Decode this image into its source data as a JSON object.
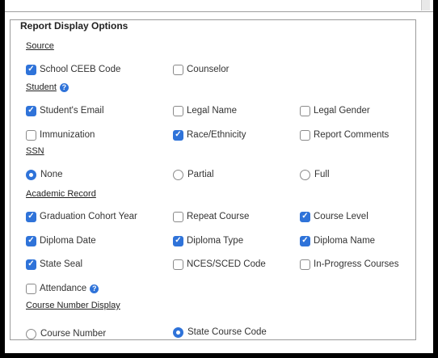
{
  "colors": {
    "accent": "#2f73d9",
    "border": "#9a9a9a",
    "text": "#222222"
  },
  "fieldset": {
    "legend": "Report Display Options"
  },
  "source": {
    "label": "Source",
    "options": [
      {
        "label": "School CEEB Code",
        "checked": true
      },
      {
        "label": "Counselor",
        "checked": false
      }
    ]
  },
  "student": {
    "label": "Student",
    "help_icon": "help-icon",
    "options": [
      {
        "label": "Student's Email",
        "checked": true
      },
      {
        "label": "Legal Name",
        "checked": false
      },
      {
        "label": "Legal Gender",
        "checked": false
      },
      {
        "label": "Immunization",
        "checked": false
      },
      {
        "label": "Race/Ethnicity",
        "checked": true
      },
      {
        "label": "Report Comments",
        "checked": false
      }
    ]
  },
  "ssn": {
    "label": "SSN",
    "options": [
      {
        "label": "None",
        "selected": true
      },
      {
        "label": "Partial",
        "selected": false
      },
      {
        "label": "Full",
        "selected": false
      }
    ]
  },
  "academic": {
    "label": "Academic Record",
    "help_icon": "help-icon",
    "options": [
      {
        "label": "Graduation Cohort Year",
        "checked": true
      },
      {
        "label": "Repeat Course",
        "checked": false
      },
      {
        "label": "Course Level",
        "checked": true
      },
      {
        "label": "Diploma Date",
        "checked": true
      },
      {
        "label": "Diploma Type",
        "checked": true
      },
      {
        "label": "Diploma Name",
        "checked": true
      },
      {
        "label": "State Seal",
        "checked": true
      },
      {
        "label": "NCES/SCED Code",
        "checked": false
      },
      {
        "label": "In-Progress Courses",
        "checked": false
      },
      {
        "label": "Attendance",
        "checked": false
      }
    ]
  },
  "course_number_display": {
    "label": "Course Number Display",
    "options": [
      {
        "label": "Course Number",
        "selected": false
      },
      {
        "label": "State Course Code",
        "selected": true
      }
    ]
  }
}
